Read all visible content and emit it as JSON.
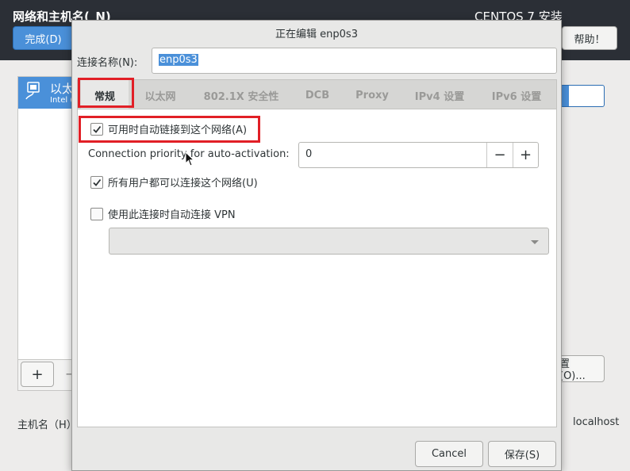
{
  "background": {
    "page_title": "网络和主机名(_N)",
    "product": "CENTOS 7 安装",
    "done_button": "完成(D)",
    "help_button": "帮助！",
    "device": {
      "name": "以太",
      "subtitle": "Intel ("
    },
    "add_button": "+",
    "remove_button": "−",
    "config_button": "置(O)...",
    "hostname_label": "主机名（H）",
    "hostname_value": "localhost"
  },
  "dialog": {
    "title": "正在编辑 enp0s3",
    "connection_name_label": "连接名称(N):",
    "connection_name_value": "enp0s3",
    "tabs": [
      {
        "label": "常规",
        "active": true
      },
      {
        "label": "以太网",
        "active": false
      },
      {
        "label": "802.1X 安全性",
        "active": false
      },
      {
        "label": "DCB",
        "active": false
      },
      {
        "label": "Proxy",
        "active": false
      },
      {
        "label": "IPv4 设置",
        "active": false
      },
      {
        "label": "IPv6 设置",
        "active": false
      }
    ],
    "general": {
      "auto_connect_label": "可用时自动链接到这个网络(A)",
      "auto_connect_checked": true,
      "priority_label": "Connection priority for auto-activation:",
      "priority_value": "0",
      "priority_minus": "−",
      "priority_plus": "+",
      "all_users_label": "所有用户都可以连接这个网络(U)",
      "all_users_checked": true,
      "vpn_label": "使用此连接时自动连接 VPN",
      "vpn_checked": false,
      "vpn_selected": ""
    },
    "cancel_button": "Cancel",
    "save_button": "保存(S)"
  },
  "colors": {
    "accent": "#4a90d9",
    "highlight_red": "#e11f26",
    "header_dark": "#2b2f36"
  }
}
